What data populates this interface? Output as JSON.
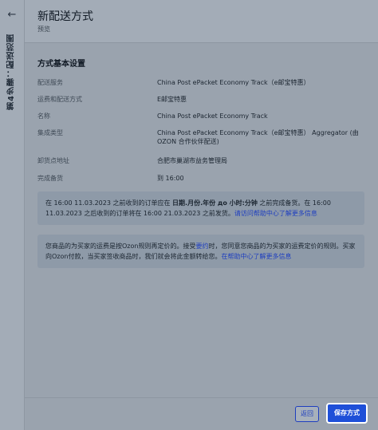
{
  "side_rail": {
    "step_label": "第4步骤：配送范围"
  },
  "header": {
    "title": "新配送方式",
    "subtitle": "预览"
  },
  "section": {
    "title": "方式基本设置",
    "rows": [
      {
        "label": "配送服务",
        "value": "China Post ePacket Economy Track（e邮宝特惠）"
      },
      {
        "label": "运费和配送方式",
        "value": "E邮宝特惠"
      },
      {
        "label": "名称",
        "value": "China Post ePacket Economy Track"
      },
      {
        "label": "集成类型",
        "value": "China Post ePacket Economy Track（e邮宝特惠） Aggregator (由 OZON 合作伙伴配送)"
      },
      {
        "label": "卸货点地址",
        "value": "合肥市巢湖市益务管理局"
      },
      {
        "label": "完成备货",
        "value": "到 16:00"
      }
    ]
  },
  "info1": {
    "t1": "在 16:00 11.03.2023 之前收到的订单应在 ",
    "bold": "日期.月份.年份 до 小时:分钟",
    "t2": " 之前完成备货。在 16:00 11.03.2023 之后收到的订单将在 16:00 21.03.2023 之前发货。",
    "link": "请访问帮助中心了解更多信息"
  },
  "info2": {
    "t1": "您商品的为买家的运费是按Ozon规则再定价的。接受",
    "agreement_link": "要约",
    "t2": "时，您同意您商品的为买家的运费定价的规则。买家向Ozon付款，当买家签收商品时，我们就会将此金额转给您。",
    "link": "在帮助中心了解更多信息"
  },
  "footer": {
    "back_label": "返回",
    "save_label": "保存方式"
  }
}
